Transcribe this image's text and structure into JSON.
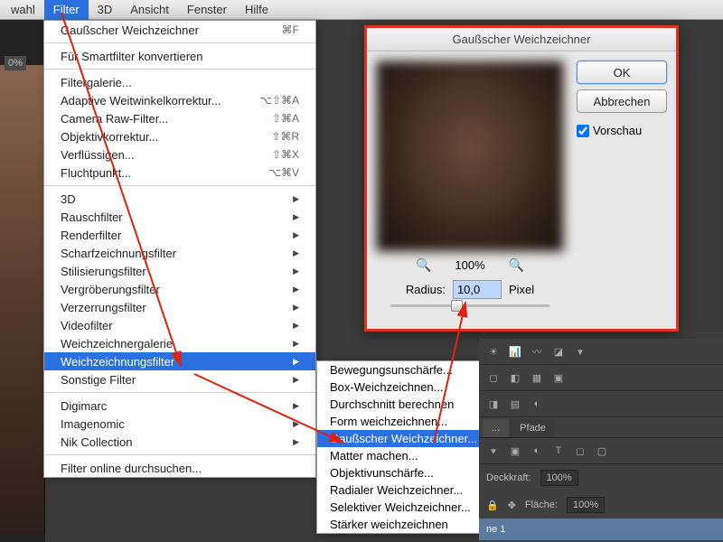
{
  "menubar": {
    "items": [
      "wahl",
      "Filter",
      "3D",
      "Ansicht",
      "Fenster",
      "Hilfe"
    ],
    "active_index": 1
  },
  "toolbar": {
    "zoom_pct": "0%"
  },
  "filter_menu": {
    "last_filter": {
      "label": "Gaußscher Weichzeichner",
      "shortcut": "⌘F"
    },
    "smart": "Für Smartfilter konvertieren",
    "group1": [
      {
        "label": "Filtergalerie..."
      },
      {
        "label": "Adaptive Weitwinkelkorrektur...",
        "shortcut": "⌥⇧⌘A"
      },
      {
        "label": "Camera Raw-Filter...",
        "shortcut": "⇧⌘A"
      },
      {
        "label": "Objektivkorrektur...",
        "shortcut": "⇧⌘R"
      },
      {
        "label": "Verflüssigen...",
        "shortcut": "⇧⌘X"
      },
      {
        "label": "Fluchtpunkt...",
        "shortcut": "⌥⌘V"
      }
    ],
    "group2": [
      "3D",
      "Rauschfilter",
      "Renderfilter",
      "Scharfzeichnungsfilter",
      "Stilisierungsfilter",
      "Vergröberungsfilter",
      "Verzerrungsfilter",
      "Videofilter",
      "Weichzeichnergalerie",
      "Weichzeichnungsfilter",
      "Sonstige Filter"
    ],
    "group3": [
      "Digimarc",
      "Imagenomic",
      "Nik Collection"
    ],
    "browse": "Filter online durchsuchen...",
    "highlighted_index": 9
  },
  "submenu": {
    "items": [
      "Bewegungsunschärfe...",
      "Box-Weichzeichnen...",
      "Durchschnitt berechnen",
      "Form weichzeichnen...",
      "Gaußscher Weichzeichner...",
      "Matter machen...",
      "Objektivunschärfe...",
      "Radialer Weichzeichner...",
      "Selektiver Weichzeichner...",
      "Stärker weichzeichnen"
    ],
    "highlighted_index": 4
  },
  "dialog": {
    "title": "Gaußscher Weichzeichner",
    "ok": "OK",
    "cancel": "Abbrechen",
    "preview_label": "Vorschau",
    "preview_checked": true,
    "zoom_pct": "100%",
    "radius_label": "Radius:",
    "radius_value": "10,0",
    "radius_unit": "Pixel"
  },
  "panels": {
    "tabs": [
      "...",
      "Pfade"
    ],
    "opacity_label": "Deckkraft:",
    "opacity_value": "100%",
    "fill_label": "Fläche:",
    "fill_value": "100%",
    "layer_name": "ne 1"
  }
}
